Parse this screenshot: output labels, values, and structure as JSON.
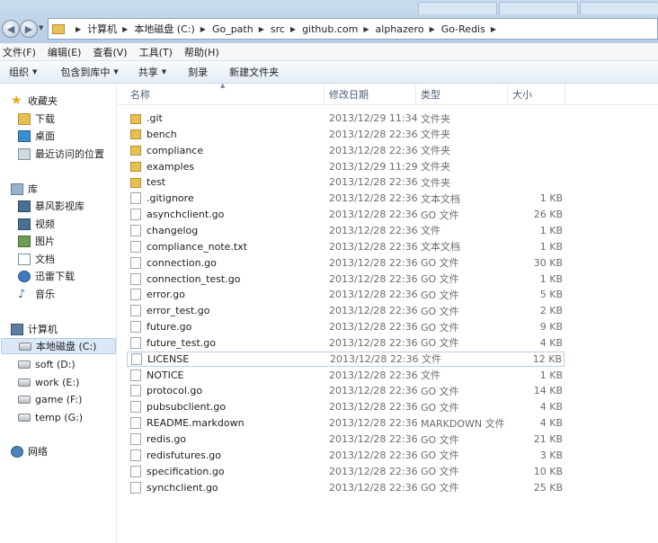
{
  "address": {
    "crumbs": [
      "计算机",
      "本地磁盘 (C:)",
      "Go_path",
      "src",
      "github.com",
      "alphazero",
      "Go-Redis"
    ]
  },
  "menu": [
    "文件(F)",
    "编辑(E)",
    "查看(V)",
    "工具(T)",
    "帮助(H)"
  ],
  "toolbar": {
    "organize": "组织",
    "include_library": "包含到库中",
    "share": "共享",
    "burn": "刻录",
    "new_folder": "新建文件夹"
  },
  "navpane": {
    "favorites": "收藏夹",
    "downloads": "下载",
    "desktop": "桌面",
    "recent": "最近访问的位置",
    "libraries": "库",
    "storm": "暴风影视库",
    "videos": "视频",
    "pictures": "图片",
    "documents": "文档",
    "thunder": "迅雷下载",
    "music": "音乐",
    "computer": "计算机",
    "drive_c": "本地磁盘 (C:)",
    "drive_d": "soft (D:)",
    "drive_e": "work (E:)",
    "drive_f": "game (F:)",
    "drive_g": "temp (G:)",
    "network": "网络"
  },
  "columns": {
    "name": "名称",
    "date": "修改日期",
    "type": "类型",
    "size": "大小"
  },
  "files": [
    {
      "name": ".git",
      "date": "2013/12/29 11:34",
      "type": "文件夹",
      "size": "",
      "kind": "folder"
    },
    {
      "name": "bench",
      "date": "2013/12/28 22:36",
      "type": "文件夹",
      "size": "",
      "kind": "folder"
    },
    {
      "name": "compliance",
      "date": "2013/12/28 22:36",
      "type": "文件夹",
      "size": "",
      "kind": "folder"
    },
    {
      "name": "examples",
      "date": "2013/12/29 11:29",
      "type": "文件夹",
      "size": "",
      "kind": "folder"
    },
    {
      "name": "test",
      "date": "2013/12/28 22:36",
      "type": "文件夹",
      "size": "",
      "kind": "folder"
    },
    {
      "name": ".gitignore",
      "date": "2013/12/28 22:36",
      "type": "文本文档",
      "size": "1 KB",
      "kind": "file"
    },
    {
      "name": "asynchclient.go",
      "date": "2013/12/28 22:36",
      "type": "GO 文件",
      "size": "26 KB",
      "kind": "file"
    },
    {
      "name": "changelog",
      "date": "2013/12/28 22:36",
      "type": "文件",
      "size": "1 KB",
      "kind": "file"
    },
    {
      "name": "compliance_note.txt",
      "date": "2013/12/28 22:36",
      "type": "文本文档",
      "size": "1 KB",
      "kind": "file"
    },
    {
      "name": "connection.go",
      "date": "2013/12/28 22:36",
      "type": "GO 文件",
      "size": "30 KB",
      "kind": "file"
    },
    {
      "name": "connection_test.go",
      "date": "2013/12/28 22:36",
      "type": "GO 文件",
      "size": "1 KB",
      "kind": "file"
    },
    {
      "name": "error.go",
      "date": "2013/12/28 22:36",
      "type": "GO 文件",
      "size": "5 KB",
      "kind": "file"
    },
    {
      "name": "error_test.go",
      "date": "2013/12/28 22:36",
      "type": "GO 文件",
      "size": "2 KB",
      "kind": "file"
    },
    {
      "name": "future.go",
      "date": "2013/12/28 22:36",
      "type": "GO 文件",
      "size": "9 KB",
      "kind": "file"
    },
    {
      "name": "future_test.go",
      "date": "2013/12/28 22:36",
      "type": "GO 文件",
      "size": "4 KB",
      "kind": "file"
    },
    {
      "name": "LICENSE",
      "date": "2013/12/28 22:36",
      "type": "文件",
      "size": "12 KB",
      "kind": "file"
    },
    {
      "name": "NOTICE",
      "date": "2013/12/28 22:36",
      "type": "文件",
      "size": "1 KB",
      "kind": "file"
    },
    {
      "name": "protocol.go",
      "date": "2013/12/28 22:36",
      "type": "GO 文件",
      "size": "14 KB",
      "kind": "file"
    },
    {
      "name": "pubsubclient.go",
      "date": "2013/12/28 22:36",
      "type": "GO 文件",
      "size": "4 KB",
      "kind": "file"
    },
    {
      "name": "README.markdown",
      "date": "2013/12/28 22:36",
      "type": "MARKDOWN 文件",
      "size": "4 KB",
      "kind": "file"
    },
    {
      "name": "redis.go",
      "date": "2013/12/28 22:36",
      "type": "GO 文件",
      "size": "21 KB",
      "kind": "file"
    },
    {
      "name": "redisfutures.go",
      "date": "2013/12/28 22:36",
      "type": "GO 文件",
      "size": "3 KB",
      "kind": "file"
    },
    {
      "name": "specification.go",
      "date": "2013/12/28 22:36",
      "type": "GO 文件",
      "size": "10 KB",
      "kind": "file"
    },
    {
      "name": "synchclient.go",
      "date": "2013/12/28 22:36",
      "type": "GO 文件",
      "size": "25 KB",
      "kind": "file"
    }
  ],
  "selected_file": "LICENSE"
}
